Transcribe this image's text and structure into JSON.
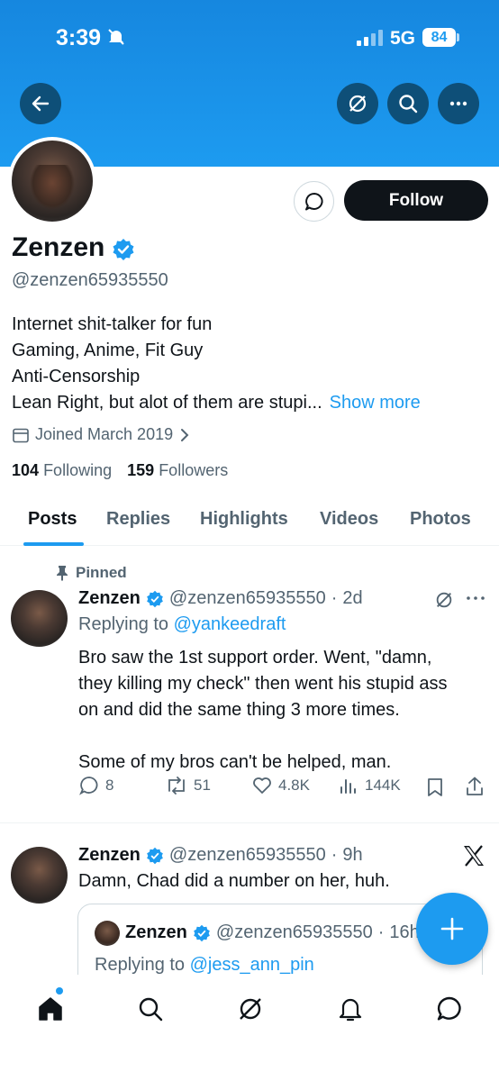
{
  "status_bar": {
    "time": "3:39",
    "network": "5G",
    "battery": "84"
  },
  "profile": {
    "name": "Zenzen",
    "handle": "@zenzen65935550",
    "bio": [
      "Internet shit-talker for fun",
      "Gaming, Anime, Fit Guy",
      "Anti-Censorship",
      "Lean Right, but alot of them are stupi..."
    ],
    "show_more": "Show more",
    "joined": "Joined March 2019",
    "following_count": "104",
    "following_label": "Following",
    "followers_count": "159",
    "followers_label": "Followers",
    "follow_label": "Follow"
  },
  "tabs": [
    "Posts",
    "Replies",
    "Highlights",
    "Videos",
    "Photos"
  ],
  "pinned_label": "Pinned",
  "post1": {
    "name": "Zenzen",
    "handle": "@zenzen65935550",
    "time": "2d",
    "replying_label": "Replying to",
    "replying_to": "@yankeedraft",
    "text_lines": [
      "Bro saw the 1st support order. Went, \"damn,",
      "they killing my check\" then went his stupid ass",
      "on and did the same thing 3 more times.",
      "",
      "Some of my bros can't be helped, man."
    ],
    "replies": "8",
    "reposts": "51",
    "likes": "4.8K",
    "views": "144K"
  },
  "post2": {
    "name": "Zenzen",
    "handle": "@zenzen65935550",
    "time": "9h",
    "text": "Damn, Chad did a number on her, huh.",
    "quote": {
      "name": "Zenzen",
      "handle": "@zenzen65935550",
      "time": "16h",
      "replying_label": "Replying to",
      "replying_to": "@jess_ann_pin"
    }
  },
  "colors": {
    "accent": "#1d9bf0",
    "text": "#0f1419",
    "muted": "#536471"
  },
  "icons": [
    "back-arrow-icon",
    "grok-icon",
    "search-icon",
    "more-icon",
    "message-icon",
    "verified-badge-icon",
    "calendar-icon",
    "pin-icon",
    "reply-icon",
    "repost-icon",
    "like-icon",
    "views-icon",
    "bookmark-icon",
    "share-icon",
    "x-logo-icon",
    "plus-icon",
    "home-icon",
    "bell-icon"
  ]
}
